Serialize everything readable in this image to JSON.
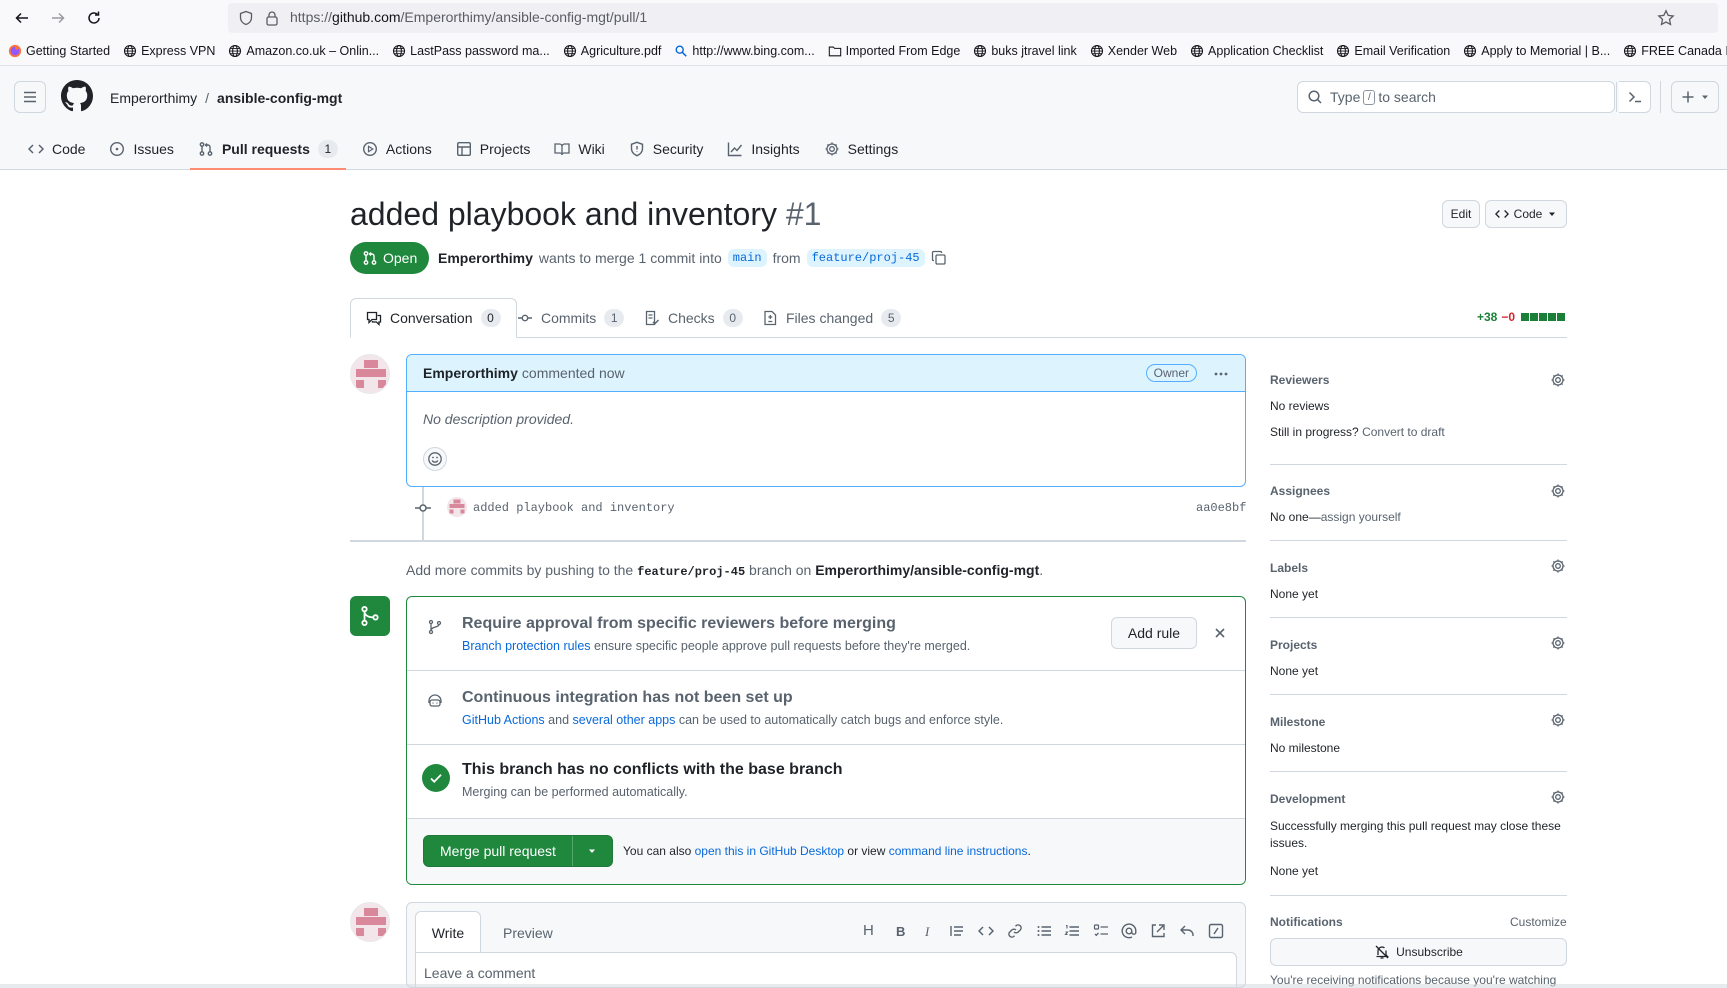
{
  "browser": {
    "url_prefix": "https://",
    "url_host": "github.com",
    "url_path": "/Emperorthimy/ansible-config-mgt/pull/1",
    "bookmarks": [
      {
        "label": "Getting Started",
        "icon": "firefox-icon"
      },
      {
        "label": "Express VPN",
        "icon": "globe-icon"
      },
      {
        "label": "Amazon.co.uk – Onlin...",
        "icon": "globe-icon"
      },
      {
        "label": "LastPass password ma...",
        "icon": "globe-icon"
      },
      {
        "label": "Agriculture.pdf",
        "icon": "globe-icon"
      },
      {
        "label": "http://www.bing.com...",
        "icon": "search-icon"
      },
      {
        "label": "Imported From Edge",
        "icon": "folder-icon"
      },
      {
        "label": "buks jtravel link",
        "icon": "globe-icon"
      },
      {
        "label": "Xender Web",
        "icon": "globe-icon"
      },
      {
        "label": "Application Checklist",
        "icon": "globe-icon"
      },
      {
        "label": "Email Verification",
        "icon": "globe-icon"
      },
      {
        "label": "Apply to Memorial | B...",
        "icon": "globe-icon"
      },
      {
        "label": "FREE Canada Immigra...",
        "icon": "globe-icon"
      }
    ]
  },
  "header": {
    "owner": "Emperorthimy",
    "separator": "/",
    "repo": "ansible-config-mgt",
    "search_prefix": "Type",
    "search_key": "/",
    "search_suffix": "to search"
  },
  "repo_tabs": [
    {
      "label": "Code",
      "icon": "code-icon"
    },
    {
      "label": "Issues",
      "icon": "issue-icon"
    },
    {
      "label": "Pull requests",
      "icon": "pull-request-icon",
      "count": "1",
      "selected": true
    },
    {
      "label": "Actions",
      "icon": "play-icon"
    },
    {
      "label": "Projects",
      "icon": "table-icon"
    },
    {
      "label": "Wiki",
      "icon": "book-icon"
    },
    {
      "label": "Security",
      "icon": "shield-icon"
    },
    {
      "label": "Insights",
      "icon": "graph-icon"
    },
    {
      "label": "Settings",
      "icon": "gear-icon"
    }
  ],
  "pr": {
    "title": "added playbook and inventory",
    "number": "#1",
    "edit_label": "Edit",
    "code_label": "Code",
    "status": "Open",
    "author": "Emperorthimy",
    "merge_text_1": "wants to merge 1 commit into",
    "base_branch": "main",
    "merge_text_2": "from",
    "head_branch": "feature/proj-45",
    "additions": "+38",
    "deletions": "−0"
  },
  "pr_tabs": [
    {
      "label": "Conversation",
      "count": "0",
      "icon": "comment-icon"
    },
    {
      "label": "Commits",
      "count": "1",
      "icon": "commit-icon"
    },
    {
      "label": "Checks",
      "count": "0",
      "icon": "checklist-icon"
    },
    {
      "label": "Files changed",
      "count": "5",
      "icon": "file-diff-icon"
    }
  ],
  "comment": {
    "author": "Emperorthimy",
    "time": "commented now",
    "role": "Owner",
    "body": "No description provided."
  },
  "commit": {
    "message": "added playbook and inventory",
    "sha": "aa0e8bf"
  },
  "push_hint": {
    "prefix": "Add more commits by pushing to the",
    "branch": "feature/proj-45",
    "middle": "branch on",
    "repo": "Emperorthimy/ansible-config-mgt",
    "suffix": "."
  },
  "merge_box": {
    "rule_title": "Require approval from specific reviewers before merging",
    "rule_link": "Branch protection rules",
    "rule_text": "ensure specific people approve pull requests before they're merged.",
    "add_rule": "Add rule",
    "ci_title": "Continuous integration has not been set up",
    "ci_link1": "GitHub Actions",
    "ci_and": "and",
    "ci_link2": "several other apps",
    "ci_text": "can be used to automatically catch bugs and enforce style.",
    "conflict_title": "This branch has no conflicts with the base branch",
    "conflict_text": "Merging can be performed automatically.",
    "merge_button": "Merge pull request",
    "also_text": "You can also",
    "desktop_link": "open this in GitHub Desktop",
    "or_view": "or view",
    "cli_link": "command line instructions",
    "period": "."
  },
  "sidebar": {
    "reviewers_head": "Reviewers",
    "reviewers_val": "No reviews",
    "progress_text": "Still in progress?",
    "draft_link": "Convert to draft",
    "assignees_head": "Assignees",
    "assignees_val": "No one—",
    "assign_link": "assign yourself",
    "labels_head": "Labels",
    "labels_val": "None yet",
    "projects_head": "Projects",
    "projects_val": "None yet",
    "milestone_head": "Milestone",
    "milestone_val": "No milestone",
    "development_head": "Development",
    "development_text": "Successfully merging this pull request may close these issues.",
    "development_val": "None yet",
    "notifications_head": "Notifications",
    "customize": "Customize",
    "unsubscribe": "Unsubscribe",
    "notif_text": "You're receiving notifications because you're watching"
  },
  "editor": {
    "write_tab": "Write",
    "preview_tab": "Preview",
    "heading_tool": "H",
    "placeholder": "Leave a comment"
  },
  "colors": {
    "green": "#1f883d",
    "blue_link": "#0969da",
    "tab_underline": "#fd8c73",
    "comment_header_bg": "#ddf4ff"
  }
}
